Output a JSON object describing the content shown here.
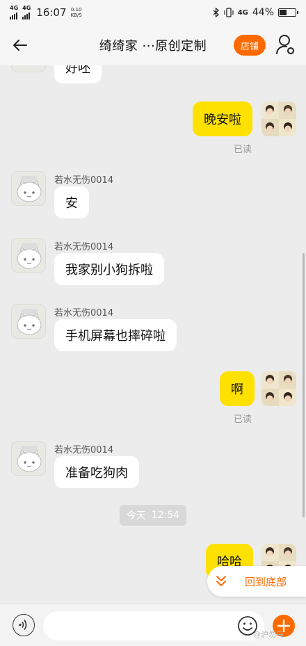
{
  "status": {
    "signal1": "4G",
    "signal2": "4G",
    "time": "16:07",
    "speed_value": "0.10",
    "speed_unit": "KB/S",
    "net": "4G",
    "battery": "44%",
    "battery_level": 0.44
  },
  "nav": {
    "title": "绮绮家 ···原创定制",
    "shop_label": "店铺"
  },
  "chat": {
    "partial_message": "好呸",
    "msg_goodnight": "晚安啦",
    "read_label": "已读",
    "nickname": "若水无伤0014",
    "avatar_tag": "欢喜猫",
    "msg_an": "安",
    "msg_dog": "我家别小狗拆啦",
    "msg_phone": "手机屏幕也摔碎啦",
    "msg_ah": "啊",
    "msg_eat": "准备吃狗肉",
    "time_day": "今天",
    "time_clock": "12:54",
    "msg_haha": "哈哈"
  },
  "back_to_bottom": "回到底部",
  "input": {
    "placeholder": ""
  },
  "watermark": "@沪勿鸟",
  "colors": {
    "accent": "#ff6a00",
    "my_bubble": "#ffe100",
    "bg": "#ececec"
  },
  "icons": {
    "back": "arrow-left-icon",
    "user": "user-settings-icon",
    "voice": "voice-icon",
    "emoji": "emoji-icon",
    "plus": "plus-icon",
    "chevrons": "double-chevron-down-icon"
  }
}
